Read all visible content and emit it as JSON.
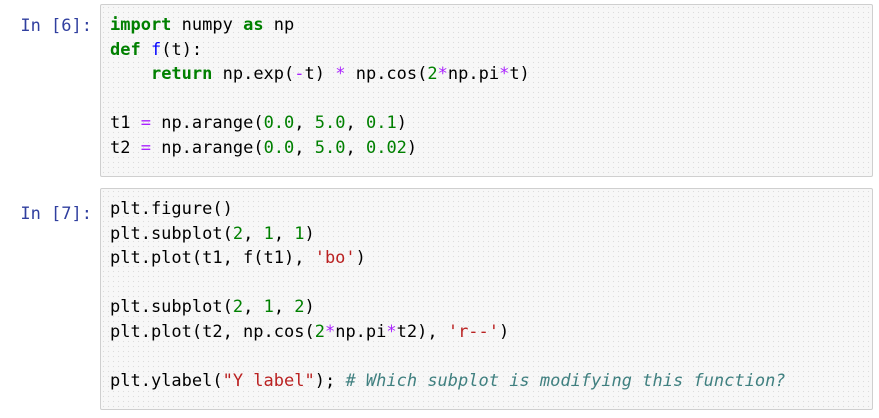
{
  "colors": {
    "prompt": "#303F9F",
    "keyword": "#008000",
    "function_name": "#0000ff",
    "number": "#008000",
    "operator": "#aa22ff",
    "string": "#ba2121",
    "comment": "#408080",
    "cell_background": "#f7f7f7",
    "cell_border": "#cfcfcf"
  },
  "cells": [
    {
      "prompt": "In [6]:",
      "lines": [
        [
          {
            "t": "kw",
            "v": "import"
          },
          {
            "t": "plain",
            "v": " numpy "
          },
          {
            "t": "kw",
            "v": "as"
          },
          {
            "t": "plain",
            "v": " np"
          }
        ],
        [
          {
            "t": "kw",
            "v": "def"
          },
          {
            "t": "plain",
            "v": " "
          },
          {
            "t": "fn",
            "v": "f"
          },
          {
            "t": "plain",
            "v": "(t):"
          }
        ],
        [
          {
            "t": "plain",
            "v": "    "
          },
          {
            "t": "kw",
            "v": "return"
          },
          {
            "t": "plain",
            "v": " np.exp("
          },
          {
            "t": "op",
            "v": "-"
          },
          {
            "t": "plain",
            "v": "t) "
          },
          {
            "t": "op",
            "v": "*"
          },
          {
            "t": "plain",
            "v": " np.cos("
          },
          {
            "t": "num",
            "v": "2"
          },
          {
            "t": "op",
            "v": "*"
          },
          {
            "t": "plain",
            "v": "np.pi"
          },
          {
            "t": "op",
            "v": "*"
          },
          {
            "t": "plain",
            "v": "t)"
          }
        ],
        [],
        [
          {
            "t": "plain",
            "v": "t1 "
          },
          {
            "t": "op",
            "v": "="
          },
          {
            "t": "plain",
            "v": " np.arange("
          },
          {
            "t": "num",
            "v": "0.0"
          },
          {
            "t": "plain",
            "v": ", "
          },
          {
            "t": "num",
            "v": "5.0"
          },
          {
            "t": "plain",
            "v": ", "
          },
          {
            "t": "num",
            "v": "0.1"
          },
          {
            "t": "plain",
            "v": ")"
          }
        ],
        [
          {
            "t": "plain",
            "v": "t2 "
          },
          {
            "t": "op",
            "v": "="
          },
          {
            "t": "plain",
            "v": " np.arange("
          },
          {
            "t": "num",
            "v": "0.0"
          },
          {
            "t": "plain",
            "v": ", "
          },
          {
            "t": "num",
            "v": "5.0"
          },
          {
            "t": "plain",
            "v": ", "
          },
          {
            "t": "num",
            "v": "0.02"
          },
          {
            "t": "plain",
            "v": ")"
          }
        ]
      ]
    },
    {
      "prompt": "In [7]:",
      "lines": [
        [
          {
            "t": "plain",
            "v": "plt.figure()"
          }
        ],
        [
          {
            "t": "plain",
            "v": "plt.subplot("
          },
          {
            "t": "num",
            "v": "2"
          },
          {
            "t": "plain",
            "v": ", "
          },
          {
            "t": "num",
            "v": "1"
          },
          {
            "t": "plain",
            "v": ", "
          },
          {
            "t": "num",
            "v": "1"
          },
          {
            "t": "plain",
            "v": ")"
          }
        ],
        [
          {
            "t": "plain",
            "v": "plt.plot(t1, f(t1), "
          },
          {
            "t": "str",
            "v": "'bo'"
          },
          {
            "t": "plain",
            "v": ")"
          }
        ],
        [],
        [
          {
            "t": "plain",
            "v": "plt.subplot("
          },
          {
            "t": "num",
            "v": "2"
          },
          {
            "t": "plain",
            "v": ", "
          },
          {
            "t": "num",
            "v": "1"
          },
          {
            "t": "plain",
            "v": ", "
          },
          {
            "t": "num",
            "v": "2"
          },
          {
            "t": "plain",
            "v": ")"
          }
        ],
        [
          {
            "t": "plain",
            "v": "plt.plot(t2, np.cos("
          },
          {
            "t": "num",
            "v": "2"
          },
          {
            "t": "op",
            "v": "*"
          },
          {
            "t": "plain",
            "v": "np.pi"
          },
          {
            "t": "op",
            "v": "*"
          },
          {
            "t": "plain",
            "v": "t2), "
          },
          {
            "t": "str",
            "v": "'r--'"
          },
          {
            "t": "plain",
            "v": ")"
          }
        ],
        [],
        [
          {
            "t": "plain",
            "v": "plt.ylabel("
          },
          {
            "t": "str",
            "v": "\"Y label\""
          },
          {
            "t": "plain",
            "v": "); "
          },
          {
            "t": "cmt",
            "v": "# Which subplot is modifying this function?"
          }
        ]
      ]
    }
  ]
}
